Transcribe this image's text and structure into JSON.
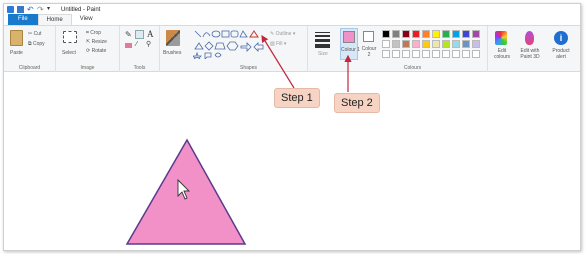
{
  "title": "Untitled - Paint",
  "tabs": [
    "File",
    "Home",
    "View"
  ],
  "clipboard": {
    "paste": "Paste",
    "cut": "Cut",
    "copy": "Copy",
    "label": "Clipboard"
  },
  "image": {
    "select": "Select",
    "crop": "Crop",
    "resize": "Resize",
    "rotate": "Rotate",
    "label": "Image"
  },
  "tools": {
    "label": "Tools",
    "brushes": "Brushes"
  },
  "shapes": {
    "label": "Shapes",
    "outline": "Outline",
    "fill": "Fill"
  },
  "size": {
    "label": "Size"
  },
  "colours": {
    "colour1": "Colour 1",
    "colour2": "Colour 2",
    "label": "Colours",
    "edit": "Edit colours",
    "paint3d": "Edit with Paint 3D",
    "product_alert": "Product alert",
    "palette_row1": [
      "#000000",
      "#7f7f7f",
      "#880015",
      "#ed1c24",
      "#ff7f27",
      "#fff200",
      "#22b14c",
      "#00a2e8",
      "#3f48cc",
      "#a349a4"
    ],
    "palette_row2": [
      "#ffffff",
      "#c3c3c3",
      "#b97a57",
      "#ffaec9",
      "#ffc90e",
      "#efe4b0",
      "#b5e61d",
      "#99d9ea",
      "#7092be",
      "#c8bfe7"
    ],
    "selected_colour": "#f291c8"
  },
  "callouts": {
    "step1": "Step 1",
    "step2": "Step 2"
  },
  "canvas": {
    "shape": "triangle",
    "fill": "#f291c8",
    "stroke": "#5b3b8c"
  }
}
